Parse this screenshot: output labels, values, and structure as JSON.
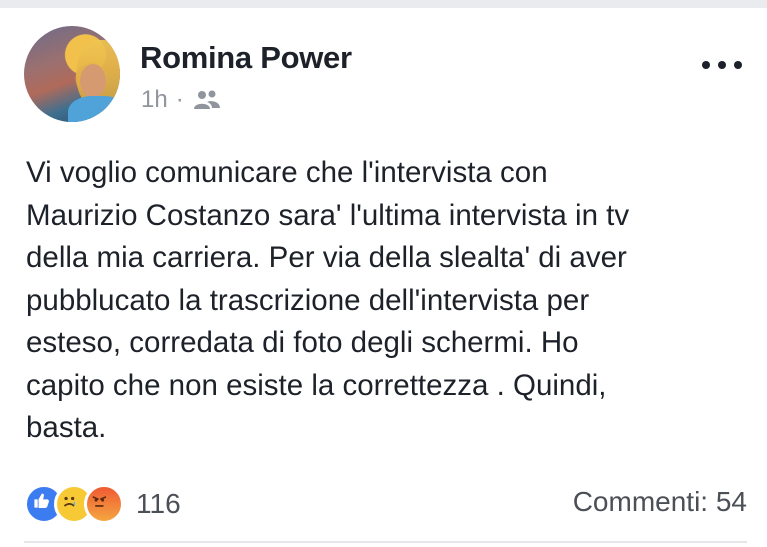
{
  "post": {
    "author": "Romina Power",
    "time": "1h",
    "separator": "·",
    "audience_icon": "friends-icon",
    "more_icon": "more-options-icon",
    "text": "Vi voglio comunicare che l'intervista con\nMaurizio Costanzo sara' l'ultima intervista in tv\ndella mia carriera. Per via della slealta' di aver\npubblucato la trascrizione dell'intervista per\nesteso, corredata di foto degli schermi. Ho\ncapito che non esiste la correttezza . Quindi,\nbasta."
  },
  "footer": {
    "reaction_icons": [
      "like-icon",
      "sad-icon",
      "angry-icon"
    ],
    "reaction_count": "116",
    "comments": "Commenti: 54"
  },
  "colors": {
    "text": "#1d2129",
    "secondary": "#90949c",
    "like": "#3b7df0",
    "sad": "#f7c935",
    "angry": "#f05a34"
  }
}
